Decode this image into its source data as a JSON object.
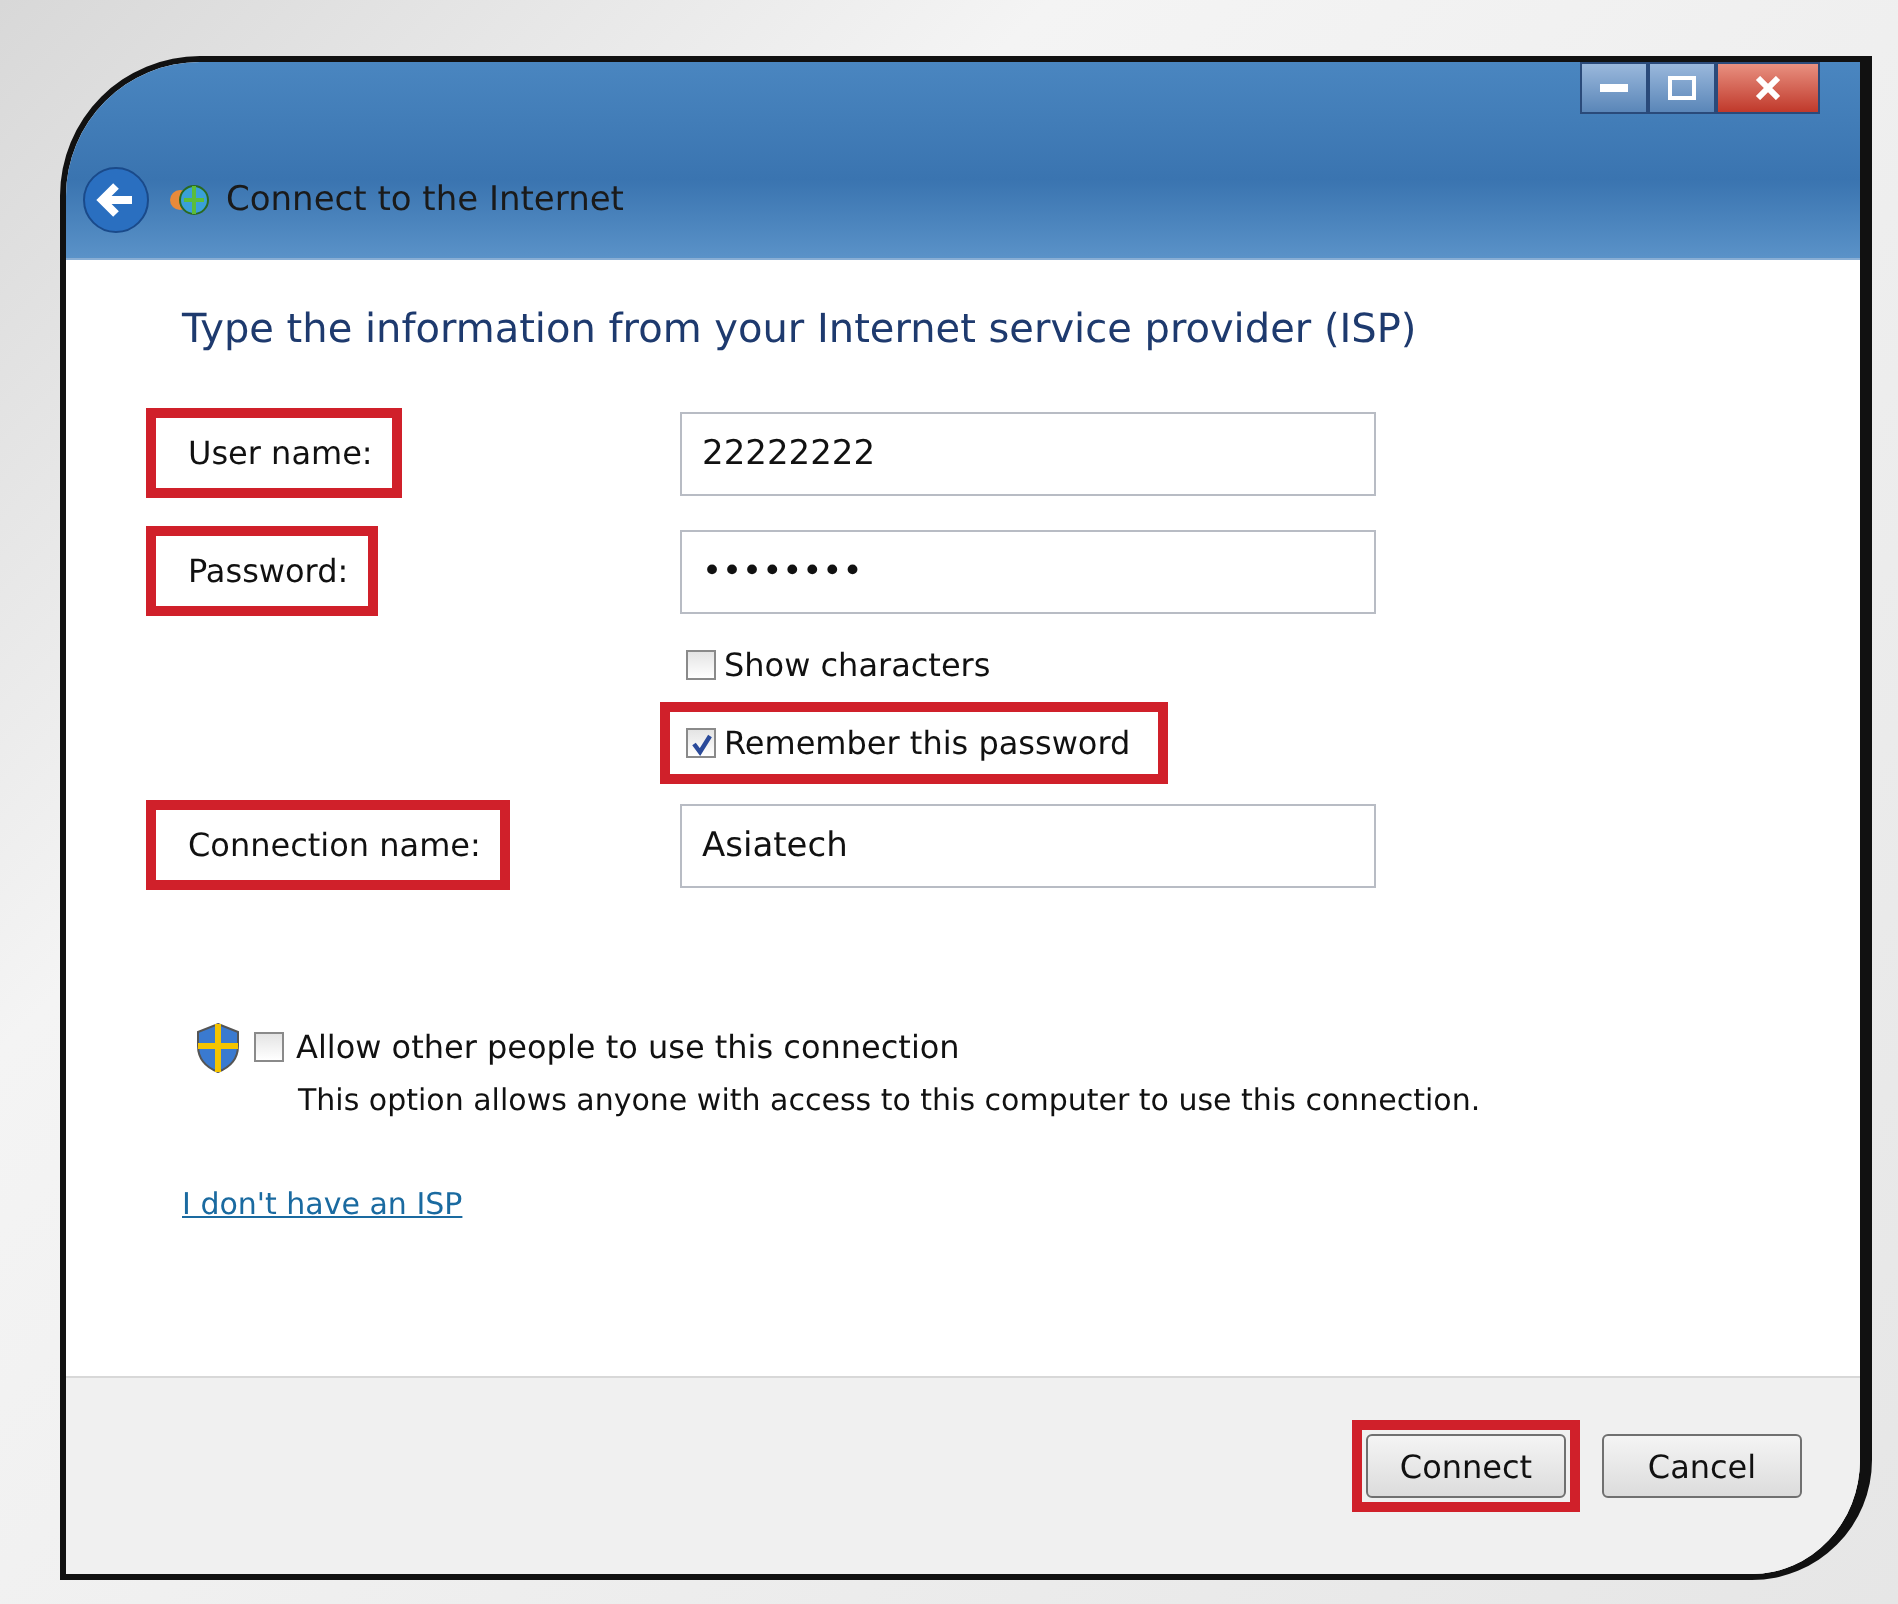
{
  "window": {
    "title": "Connect to the Internet"
  },
  "heading": "Type the information from your Internet service provider (ISP)",
  "rows": [
    {
      "kind": "field",
      "label": "User name:",
      "value": "22222222",
      "highlighted": true
    },
    {
      "kind": "field",
      "label": "Password:",
      "value": "••••••••",
      "highlighted": true
    },
    {
      "kind": "checkbox",
      "label": "Show characters",
      "checked": false,
      "highlighted": false
    },
    {
      "kind": "checkbox",
      "label": "Remember this password",
      "checked": true,
      "highlighted": true
    },
    {
      "kind": "field",
      "label": "Connection name:",
      "value": "Asiatech",
      "highlighted": true
    }
  ],
  "allow": {
    "label": "Allow other people to use this connection",
    "checked": false,
    "description": "This option allows anyone with access to this computer to use this connection."
  },
  "link": "I don't have an ISP",
  "buttons": [
    {
      "label": "Connect",
      "highlighted": true
    },
    {
      "label": "Cancel",
      "highlighted": false
    }
  ]
}
